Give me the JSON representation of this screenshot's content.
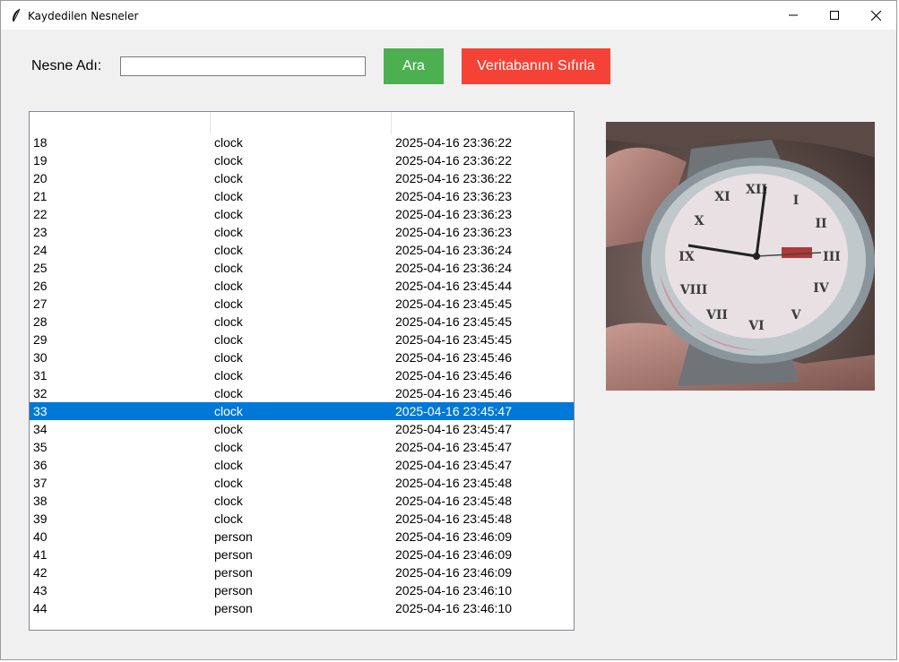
{
  "window": {
    "title": "Kaydedilen Nesneler"
  },
  "search": {
    "label": "Nesne Adı:",
    "value": "",
    "search_button": "Ara",
    "reset_button": "Veritabanını Sıfırla"
  },
  "colors": {
    "search_button": "#4caf50",
    "reset_button": "#f44336",
    "selection": "#0078d7"
  },
  "table": {
    "headers": [
      "",
      "",
      ""
    ],
    "selected_id": "33",
    "rows": [
      {
        "id": "18",
        "name": "clock",
        "time": "2025-04-16 23:36:22"
      },
      {
        "id": "19",
        "name": "clock",
        "time": "2025-04-16 23:36:22"
      },
      {
        "id": "20",
        "name": "clock",
        "time": "2025-04-16 23:36:22"
      },
      {
        "id": "21",
        "name": "clock",
        "time": "2025-04-16 23:36:23"
      },
      {
        "id": "22",
        "name": "clock",
        "time": "2025-04-16 23:36:23"
      },
      {
        "id": "23",
        "name": "clock",
        "time": "2025-04-16 23:36:23"
      },
      {
        "id": "24",
        "name": "clock",
        "time": "2025-04-16 23:36:24"
      },
      {
        "id": "25",
        "name": "clock",
        "time": "2025-04-16 23:36:24"
      },
      {
        "id": "26",
        "name": "clock",
        "time": "2025-04-16 23:45:44"
      },
      {
        "id": "27",
        "name": "clock",
        "time": "2025-04-16 23:45:45"
      },
      {
        "id": "28",
        "name": "clock",
        "time": "2025-04-16 23:45:45"
      },
      {
        "id": "29",
        "name": "clock",
        "time": "2025-04-16 23:45:45"
      },
      {
        "id": "30",
        "name": "clock",
        "time": "2025-04-16 23:45:46"
      },
      {
        "id": "31",
        "name": "clock",
        "time": "2025-04-16 23:45:46"
      },
      {
        "id": "32",
        "name": "clock",
        "time": "2025-04-16 23:45:46"
      },
      {
        "id": "33",
        "name": "clock",
        "time": "2025-04-16 23:45:47"
      },
      {
        "id": "34",
        "name": "clock",
        "time": "2025-04-16 23:45:47"
      },
      {
        "id": "35",
        "name": "clock",
        "time": "2025-04-16 23:45:47"
      },
      {
        "id": "36",
        "name": "clock",
        "time": "2025-04-16 23:45:47"
      },
      {
        "id": "37",
        "name": "clock",
        "time": "2025-04-16 23:45:48"
      },
      {
        "id": "38",
        "name": "clock",
        "time": "2025-04-16 23:45:48"
      },
      {
        "id": "39",
        "name": "clock",
        "time": "2025-04-16 23:45:48"
      },
      {
        "id": "40",
        "name": "person",
        "time": "2025-04-16 23:46:09"
      },
      {
        "id": "41",
        "name": "person",
        "time": "2025-04-16 23:46:09"
      },
      {
        "id": "42",
        "name": "person",
        "time": "2025-04-16 23:46:09"
      },
      {
        "id": "43",
        "name": "person",
        "time": "2025-04-16 23:46:10"
      },
      {
        "id": "44",
        "name": "person",
        "time": "2025-04-16 23:46:10"
      }
    ]
  },
  "icons": {
    "app": "feather-icon",
    "minimize": "minimize-icon",
    "maximize": "maximize-icon",
    "close": "close-icon"
  }
}
